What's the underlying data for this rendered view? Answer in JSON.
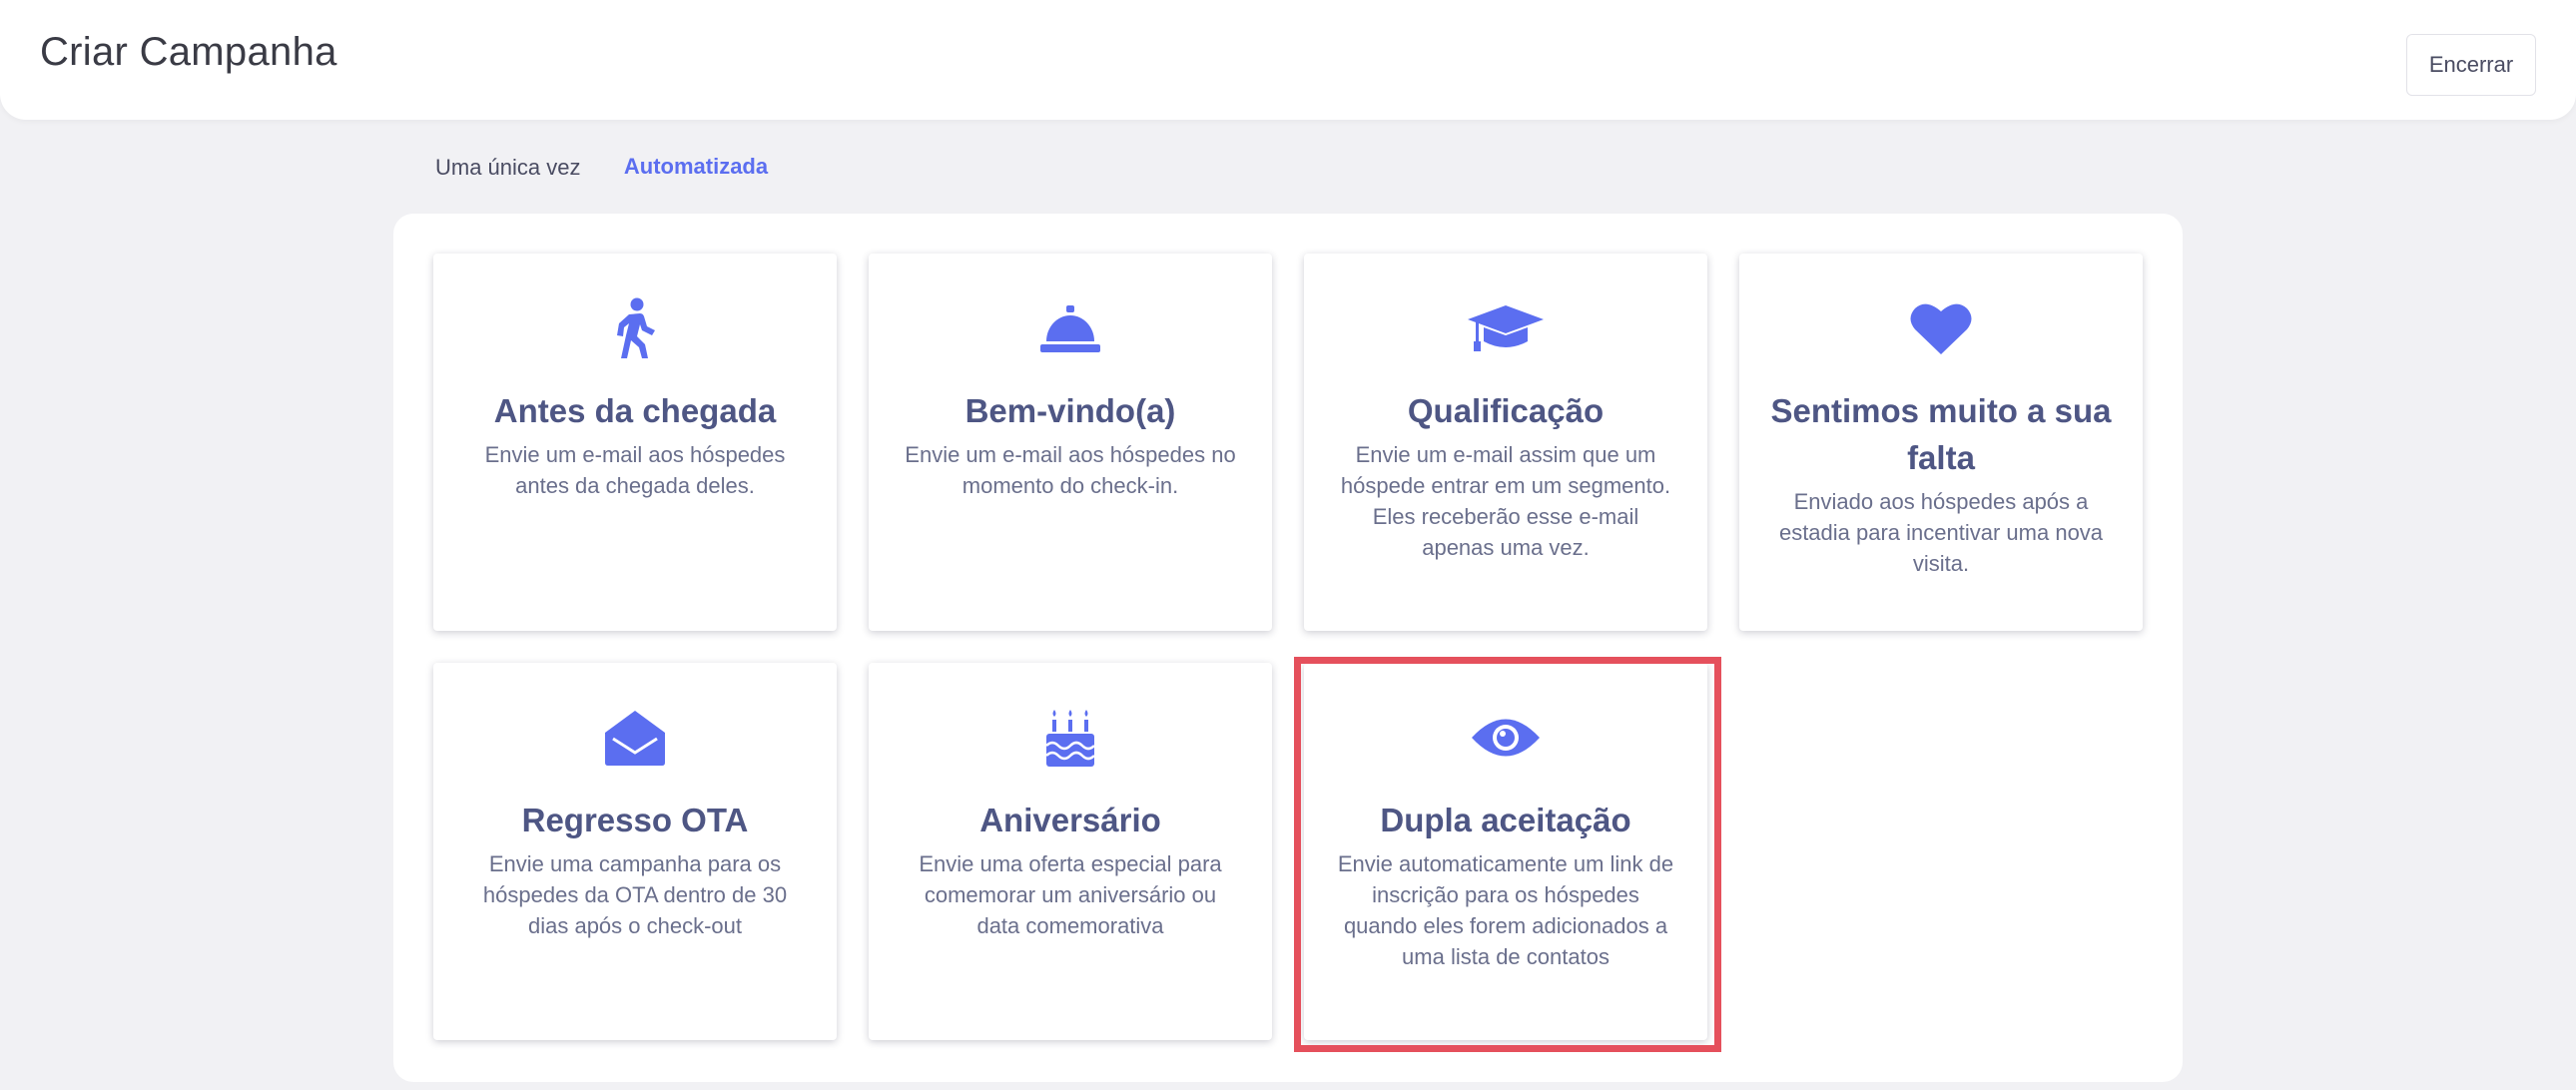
{
  "header": {
    "title": "Criar Campanha",
    "end_button_label": "Encerrar"
  },
  "tabs": [
    {
      "label": "Uma única vez",
      "active": false
    },
    {
      "label": "Automatizada",
      "active": true
    }
  ],
  "colors": {
    "accent": "#5b6ef0",
    "highlight": "#e5505c",
    "title_text": "#4e5684"
  },
  "cards": [
    {
      "icon": "person-walking-icon",
      "title": "Antes da chegada",
      "description": "Envie um e-mail aos hóspedes antes da chegada deles."
    },
    {
      "icon": "service-bell-icon",
      "title": "Bem-vindo(a)",
      "description": "Envie um e-mail aos hóspedes no momento do check-in."
    },
    {
      "icon": "graduation-cap-icon",
      "title": "Qualificação",
      "description": "Envie um e-mail assim que um hóspede entrar em um segmento. Eles receberão esse e-mail apenas uma vez."
    },
    {
      "icon": "heart-icon",
      "title": "Sentimos muito a sua falta",
      "description": "Enviado aos hóspedes após a estadia para incentivar uma nova visita."
    },
    {
      "icon": "envelope-open-icon",
      "title": "Regresso OTA",
      "description": "Envie uma campanha para os hóspedes da OTA dentro de 30 dias após o check-out"
    },
    {
      "icon": "birthday-cake-icon",
      "title": "Aniversário",
      "description": "Envie uma oferta especial para comemorar um aniversário ou data comemorativa"
    },
    {
      "icon": "eye-icon",
      "title": "Dupla aceitação",
      "description": "Envie automaticamente um link de inscrição para os hóspedes quando eles forem adicionados a uma lista de contatos",
      "highlighted": true
    }
  ]
}
